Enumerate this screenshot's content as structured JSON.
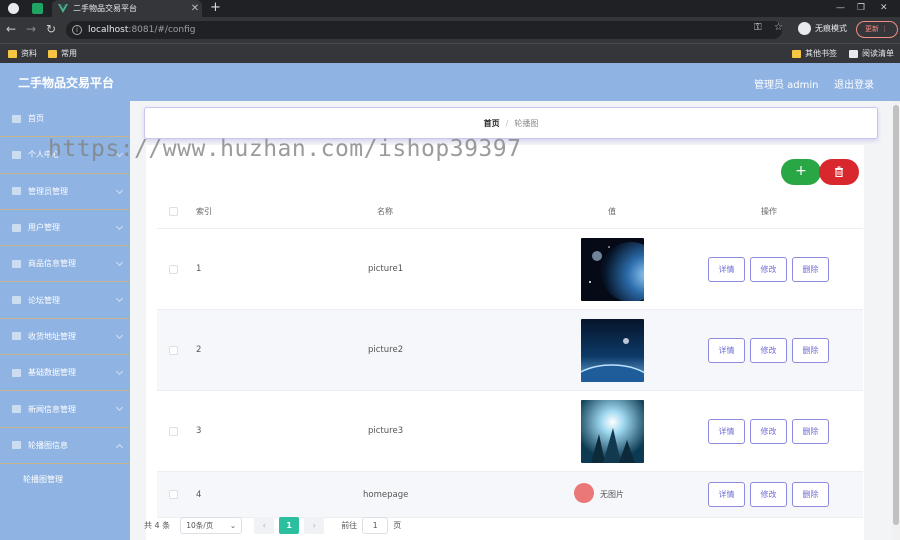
{
  "browser": {
    "tab_title": "二手物品交易平台",
    "url_host": "localhost",
    "url_rest": ":8081/#/config",
    "incognito_label": "无痕模式",
    "update_label": "更新",
    "bookmarks": [
      "资料",
      "常用"
    ],
    "other_bookmarks": "其他书签",
    "reading_list": "阅读清单"
  },
  "header": {
    "title": "二手物品交易平台",
    "admin": "管理员 admin",
    "logout": "退出登录"
  },
  "sidebar": {
    "items": [
      "首页",
      "个人中心",
      "管理员管理",
      "用户管理",
      "商品信息管理",
      "论坛管理",
      "收货地址管理",
      "基础数据管理",
      "新闻信息管理",
      "轮播图信息"
    ],
    "subitem": "轮播图管理"
  },
  "breadcrumb": {
    "home": "首页",
    "separator": "/",
    "current": "轮播图"
  },
  "toolbar": {
    "add_label": "+"
  },
  "table": {
    "headers": {
      "index": "索引",
      "name": "名称",
      "value": "值",
      "actions": "操作"
    },
    "rows": [
      {
        "index": "1",
        "name": "picture1",
        "value_image": "planet-earth-space",
        "has_image": true
      },
      {
        "index": "2",
        "name": "picture2",
        "value_image": "planet-horizon-space",
        "has_image": true
      },
      {
        "index": "3",
        "name": "picture3",
        "value_image": "light-burst-peaks",
        "has_image": true
      },
      {
        "index": "4",
        "name": "homepage",
        "value_text": "无图片",
        "has_image": false
      }
    ],
    "actions": {
      "detail": "详情",
      "edit": "修改",
      "delete": "删除"
    }
  },
  "pagination": {
    "total": "共 4 条",
    "page_size": "10条/页",
    "current_page": "1",
    "goto_label": "前往",
    "goto_value": "1",
    "page_unit": "页"
  },
  "watermark": "https://www.huzhan.com/ishop39397",
  "colors": {
    "accent": "#8fb3e3",
    "add": "#29a745",
    "delete": "#d9272e",
    "page_active": "#2bbfa0",
    "op_border": "#8d8be0"
  }
}
